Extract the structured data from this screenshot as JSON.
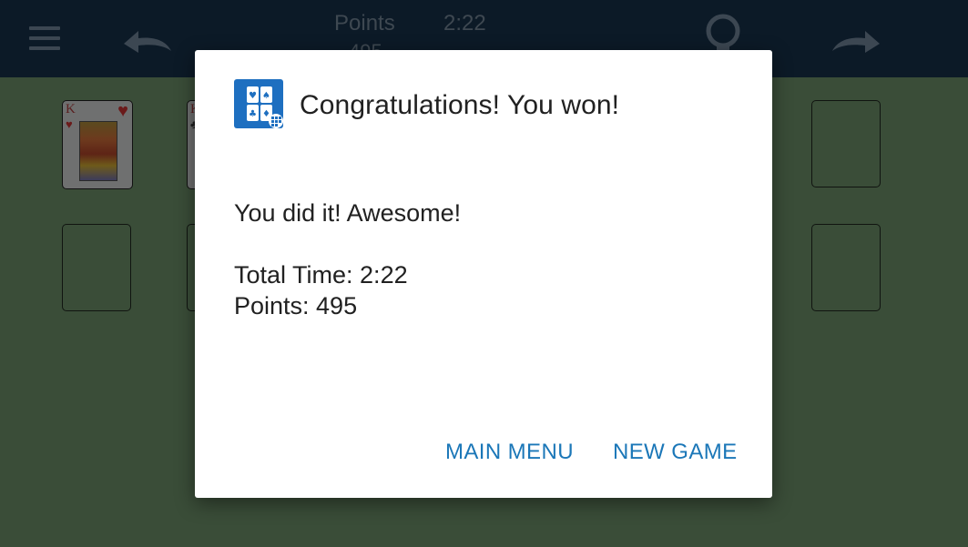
{
  "toolbar": {
    "menu_icon": "hamburger-icon",
    "undo_icon": "undo-icon",
    "hint_icon": "lightbulb-icon",
    "redo_icon": "redo-icon",
    "points_label": "Points",
    "points_value": "495",
    "time_value": "2:22"
  },
  "board": {
    "top_left_card": {
      "rank": "K",
      "suit": "♥"
    },
    "second_card": {
      "rank": "K",
      "suit": "♣"
    }
  },
  "dialog": {
    "icon": "solitaire-app-icon",
    "title": "Congratulations! You won!",
    "message": "You did it! Awesome!",
    "total_time_line": "Total Time: 2:22",
    "points_line": "Points: 495",
    "buttons": {
      "main_menu": "MAIN MENU",
      "new_game": "NEW GAME"
    }
  },
  "colors": {
    "topbar": "#0c1a27",
    "felt_dimmed": "#3a4d38",
    "button_text": "#1b77b8",
    "icon_blue": "#1e6fc0"
  }
}
